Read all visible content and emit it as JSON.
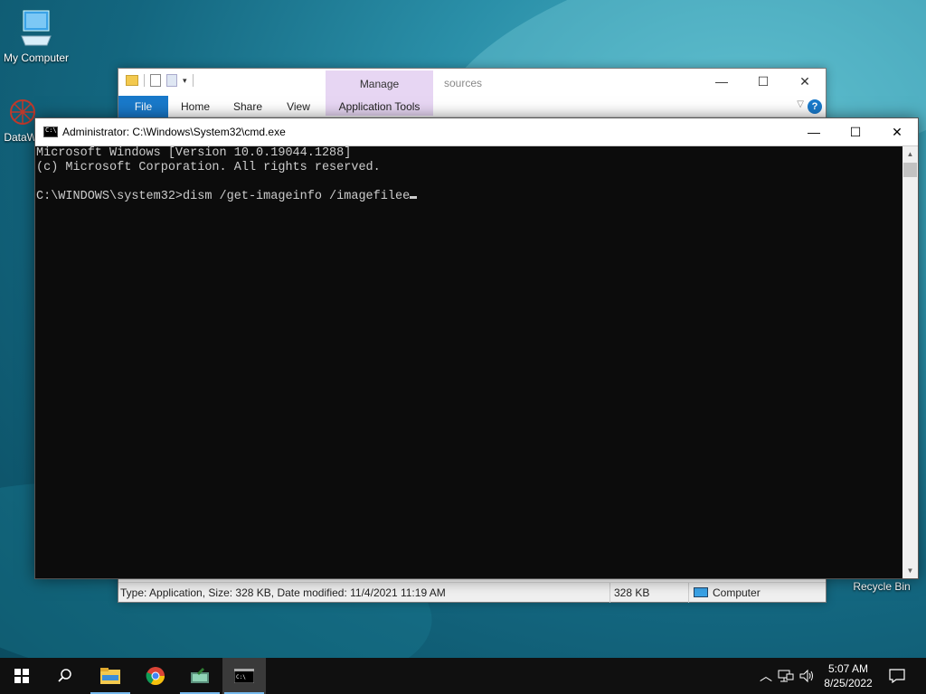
{
  "desktop": {
    "icons": [
      {
        "label": "My Computer"
      },
      {
        "label": "DataW"
      },
      {
        "label": "Recycle Bin"
      }
    ]
  },
  "explorer": {
    "manage_label": "Manage",
    "path": "sources",
    "tabs": [
      "File",
      "Home",
      "Share",
      "View",
      "Application Tools"
    ],
    "status": {
      "info": "Type: Application, Size: 328 KB, Date modified: 11/4/2021 11:19 AM",
      "size": "328 KB",
      "location": "Computer"
    }
  },
  "cmd": {
    "title": "Administrator: C:\\Windows\\System32\\cmd.exe",
    "lines": [
      "Microsoft Windows [Version 10.0.19044.1288]",
      "(c) Microsoft Corporation. All rights reserved.",
      "",
      "C:\\WINDOWS\\system32>dism /get-imageinfo /imagefilee"
    ]
  },
  "taskbar": {
    "time": "5:07 AM",
    "date": "8/25/2022"
  },
  "colors": {
    "accent": "#1979ca",
    "console_bg": "#0c0c0c",
    "console_fg": "#cccccc",
    "manage_band": "#e7d6f3"
  }
}
